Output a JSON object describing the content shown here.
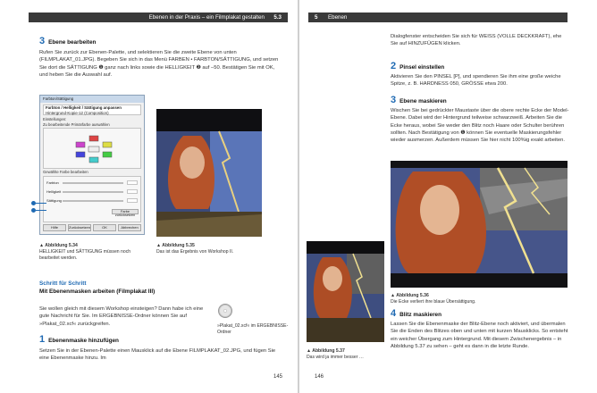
{
  "left_page": {
    "header": {
      "title": "Ebenen in der Praxis – ein Filmplakat gestalten",
      "section": "5.3"
    },
    "step3": {
      "number": "3",
      "title": "Ebene bearbeiten"
    },
    "step3_body": "Rufen Sie zurück zur Ebenen-Palette, und selektieren Sie die zweite Ebene von unten (FILMPLAKAT_01.JPG). Begeben Sie sich in das Menü FARBEN • FARBTON/SÄTTIGUNG, und setzen Sie dort die SÄTTIGUNG ❶ ganz nach links sowie die HELLIGKEIT ❷ auf –50. Bestätigen Sie mit OK, und heben Sie die Auswahl auf.",
    "dialog": {
      "title": "Farbton/Sättigung",
      "subtitle_bold": "Farbton / Helligkeit / Sättigung anpassen",
      "subtitle": "Hintergrund-Kopie-12 (Composition)",
      "presets_label": "Einstellungen:",
      "group_label": "Zu bearbeitende Primärfarbe auswählen",
      "channels": [
        "R",
        "Y",
        "G",
        "C",
        "B",
        "M"
      ],
      "master_label": "Alle",
      "overlap_label": "Überlappen",
      "sliders_group": "Gewählte Farbe bearbeiten",
      "sliders": [
        "Farbton",
        "Helligkeit",
        "Sättigung"
      ],
      "reset_label": "Farbe zurücksetzen",
      "preview_label": "Vorschau",
      "buttons": [
        "Hilfe",
        "Zurücksetzen",
        "OK",
        "Abbrechen"
      ]
    },
    "fig534": {
      "label": "▲ Abbildung 5.34",
      "text": "HELLIGKEIT und SÄTTIGUNG müssen noch bearbeitet werden."
    },
    "fig535": {
      "label": "▲ Abbildung 5.35",
      "text": "Das ist das Ergebnis von Workshop II."
    },
    "section_heading": "Schritt für Schritt",
    "section_title": "Mit Ebenenmasken arbeiten (Filmplakat III)",
    "section_body": "Sie wollen gleich mit diesem Workshop einsteigen? Dann habe ich eine gute Nachricht für Sie. Im ERGEBNISSE-Ordner können Sie auf »Plakat_02.xcf« zurückgreifen.",
    "cd_note": "»Plakat_02.xcf« im ERGEBNISSE-Ordner",
    "step1": {
      "number": "1",
      "title": "Ebenenmaske hinzufügen"
    },
    "step1_body": "Setzen Sie in der Ebenen-Palette einen Mausklick auf die Ebene FILMPLAKAT_02.JPG, und fügen Sie eine Ebenenmaske hinzu. Im",
    "page_number": "145"
  },
  "right_page": {
    "header": {
      "section": "5",
      "title": "Ebenen"
    },
    "intro_body": "Dialogfenster entscheiden Sie sich für WEISS (VOLLE DECKKRAFT), ehe Sie auf HINZUFÜGEN klicken.",
    "step2": {
      "number": "2",
      "title": "Pinsel einstellen"
    },
    "step2_body": "Aktivieren Sie den PINSEL [P], und spendieren Sie ihm eine große weiche Spitze, z. B. HARDNESS 050, GRÖSSE etwa 200.",
    "step3": {
      "number": "3",
      "title": "Ebene maskieren"
    },
    "step3_body": "Wischen Sie bei gedrückter Maustaste über die obere rechte Ecke der Model-Ebene. Dabei wird der Hintergrund teilweise schwarzweiß. Arbeiten Sie die Ecke heraus, wobei Sie weder den Blitz noch Haare oder Schulter berühren sollten. Nach Bestätigung von ❶ können Sie eventuelle Maskierungsfehler wieder ausmerzen. Außerdem müssen Sie hier nicht 100%ig exakt arbeiten.",
    "fig536": {
      "label": "▲ Abbildung 5.36",
      "text": "Die Ecke verliert ihre blaue Übersättigung."
    },
    "fig537": {
      "label": "▲ Abbildung 5.37",
      "text": "Das wird ja immer besser …"
    },
    "step4": {
      "number": "4",
      "title": "Blitz maskieren"
    },
    "step4_body": "Lassen Sie die Ebenenmaske der Blitz-Ebene noch aktiviert, und übermalen Sie die Enden des Blitzes oben und unten mit kurzen Mausklicks. So entsteht ein weicher Übergang zum Hintergrund. Mit diesem Zwischenergebnis – in Abbildung 5.37 zu sehen – geht es dann in die letzte Runde.",
    "page_number": "146"
  },
  "colors": {
    "accent": "#1f6ab3",
    "header_bar": "#3a3a3a"
  }
}
